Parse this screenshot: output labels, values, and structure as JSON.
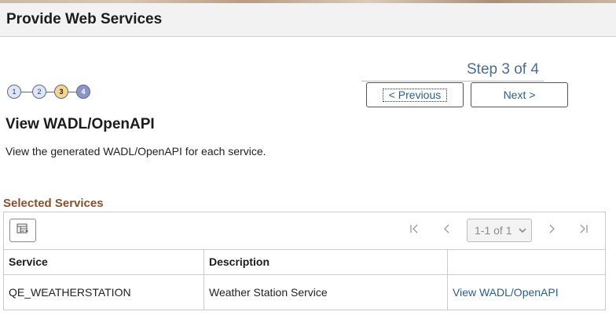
{
  "header": {
    "title": "Provide Web Services"
  },
  "wizard": {
    "step_label": "Step 3 of 4",
    "steps": [
      {
        "label": "1",
        "state": "done"
      },
      {
        "label": "2",
        "state": "done"
      },
      {
        "label": "3",
        "state": "current"
      },
      {
        "label": "4",
        "state": "future"
      }
    ],
    "previous_label": "< Previous",
    "next_label": "Next >"
  },
  "page": {
    "title": "View WADL/OpenAPI",
    "description": "View the generated WADL/OpenAPI for each service."
  },
  "grid": {
    "title": "Selected Services",
    "pager_text": "1-1 of 1",
    "columns": [
      "Service",
      "Description",
      ""
    ],
    "rows": [
      {
        "service": "QE_WEATHERSTATION",
        "description": "Weather Station Service",
        "action": "View WADL/OpenAPI"
      }
    ]
  },
  "icons": {
    "personalize": "grid-personalize-icon",
    "first": "first-page-icon",
    "prev": "previous-page-icon",
    "next": "next-page-icon",
    "last": "last-page-icon",
    "dropdown": "chevron-down-icon"
  },
  "colors": {
    "header_bg": "#f2f2f2",
    "link": "#2b5e94",
    "section_title": "#8a4f2a",
    "step_current": "#f7d58f",
    "step_future": "#8d94c7",
    "step_done": "#dfe6f6"
  }
}
